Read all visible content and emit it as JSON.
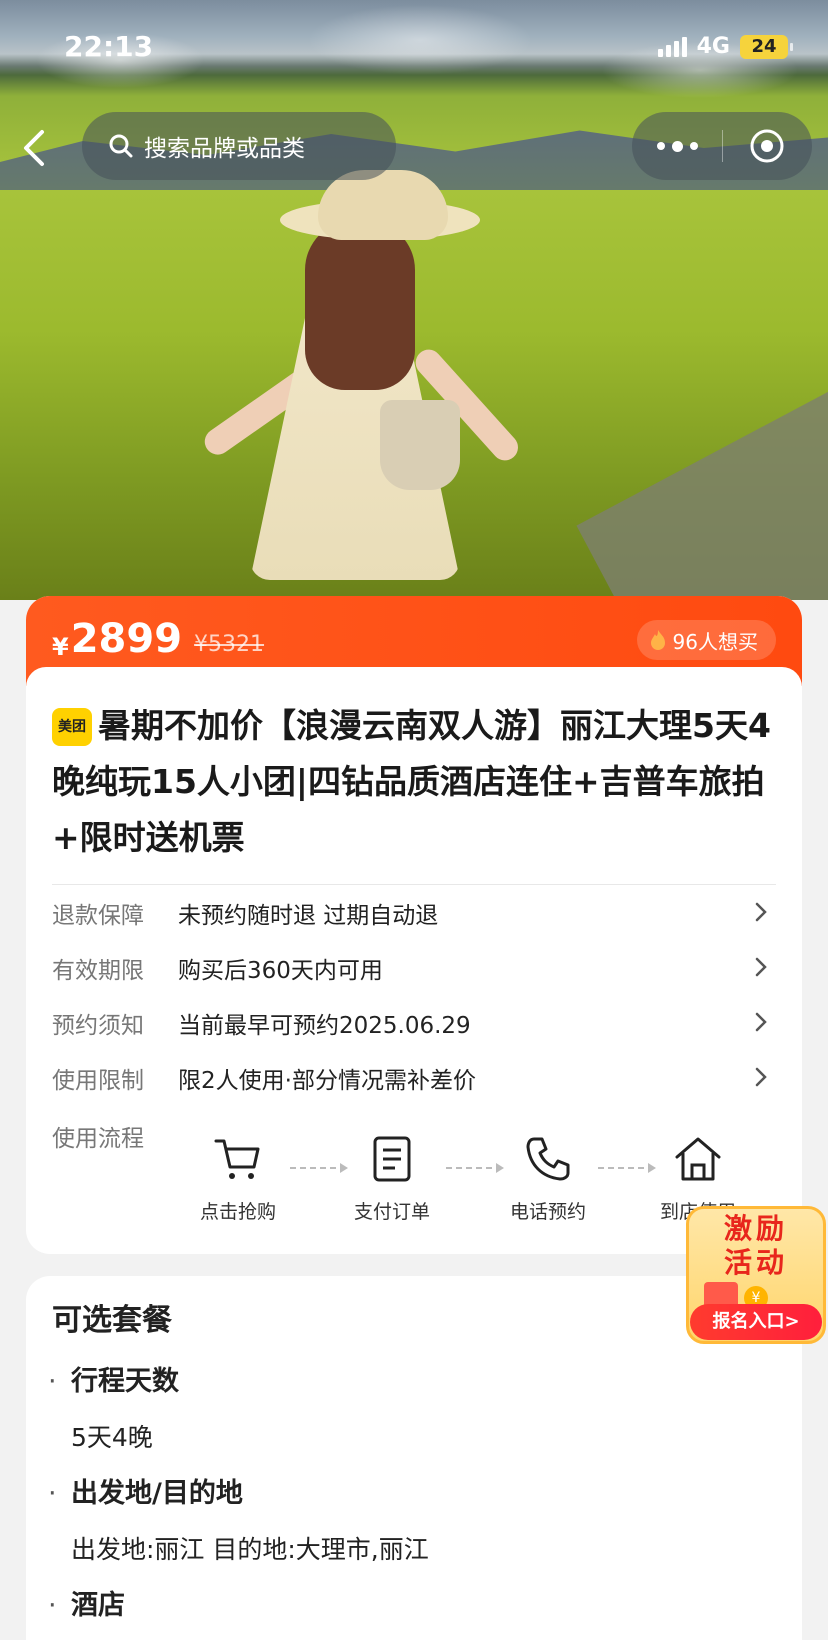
{
  "status_bar": {
    "time": "22:13",
    "network": "4G",
    "battery": "24"
  },
  "nav": {
    "search_placeholder": "搜索品牌或品类"
  },
  "product": {
    "currency": "¥",
    "price": "2899",
    "original_price": "¥5321",
    "want_count": "96人想买",
    "brand_badge": "美团",
    "title": "暑期不加价【浪漫云南双人游】丽江大理5天4晚纯玩15人小团|四钻品质酒店连住+吉普车旅拍+限时送机票"
  },
  "info_rows": [
    {
      "label": "退款保障",
      "value": "未预约随时退 过期自动退"
    },
    {
      "label": "有效期限",
      "value": "购买后360天内可用"
    },
    {
      "label": "预约须知",
      "value": "当前最早可预约2025.06.29"
    },
    {
      "label": "使用限制",
      "value": "限2人使用·部分情况需补差价"
    }
  ],
  "flow": {
    "label": "使用流程",
    "steps": [
      {
        "label": "点击抢购",
        "icon": "cart-icon"
      },
      {
        "label": "支付订单",
        "icon": "order-icon"
      },
      {
        "label": "电话预约",
        "icon": "phone-icon"
      },
      {
        "label": "到店使用",
        "icon": "home-icon"
      }
    ]
  },
  "packages": {
    "title": "可选套餐",
    "sections": [
      {
        "heading": "行程天数",
        "value": "5天4晚"
      },
      {
        "heading": "出发地/目的地",
        "value": "出发地:丽江 目的地:大理市,丽江"
      },
      {
        "heading": "酒店",
        "value": ""
      }
    ]
  },
  "promo": {
    "line1": "激励",
    "line2": "活动",
    "cta": "报名入口>"
  },
  "colors": {
    "accent": "#ff4a10",
    "brand_yellow": "#ffd100"
  }
}
